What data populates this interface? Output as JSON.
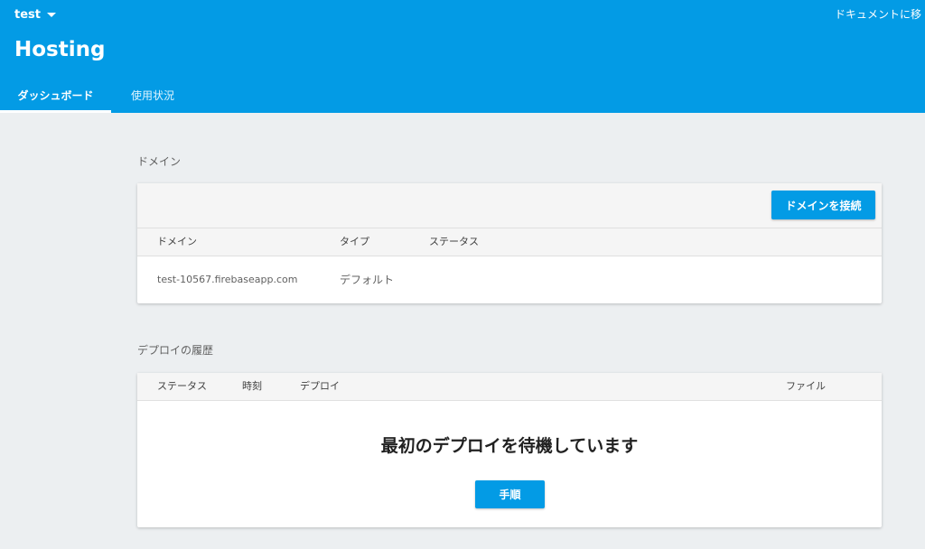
{
  "header": {
    "project_name": "test",
    "docs_link": "ドキュメントに移",
    "title": "Hosting",
    "tabs": [
      {
        "label": "ダッシュボード"
      },
      {
        "label": "使用状況"
      }
    ]
  },
  "domains": {
    "section_title": "ドメイン",
    "connect_button": "ドメインを接続",
    "columns": [
      "ドメイン",
      "タイプ",
      "ステータス"
    ],
    "rows": [
      {
        "domain": "test-10567.firebaseapp.com",
        "type": "デフォルト",
        "status": ""
      }
    ]
  },
  "deploy_history": {
    "section_title": "デプロイの履歴",
    "columns": [
      "ステータス",
      "時刻",
      "デプロイ",
      "ファイル"
    ],
    "empty_message": "最初のデプロイを待機しています",
    "instructions_button": "手順"
  },
  "colors": {
    "header_bg": "#039be5",
    "page_bg": "#eceff1",
    "accent": "#039be5"
  }
}
